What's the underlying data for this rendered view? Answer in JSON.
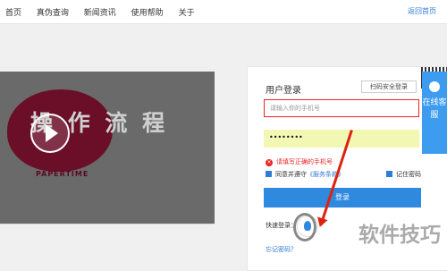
{
  "topbar": {
    "nav_items": [
      "首页",
      "真伪查询",
      "新闻资讯",
      "使用帮助",
      "关于"
    ],
    "back_home": "返回首页"
  },
  "video": {
    "title_text": "操 作 流 程",
    "brand": "PAPERTIME"
  },
  "login": {
    "title": "用户登录",
    "scan_button": "扫码安全登录",
    "phone_placeholder": "请输入你的手机号",
    "password_mask": "••••••••",
    "error_message": "请填写正确的手机号",
    "agree_prefix": "同意并遵守",
    "agree_link": "《服务条款》",
    "remember_label": "记住密码",
    "login_button": "登录",
    "quick_login_label": "快速登录：",
    "forgot_password": "忘记密码？"
  },
  "side_service": {
    "label": "在线客服"
  },
  "watermark": {
    "text": "软件技巧"
  },
  "colors": {
    "accent_blue": "#2f89df",
    "error_red": "#e22222",
    "video_maroon": "#6b0f28"
  }
}
